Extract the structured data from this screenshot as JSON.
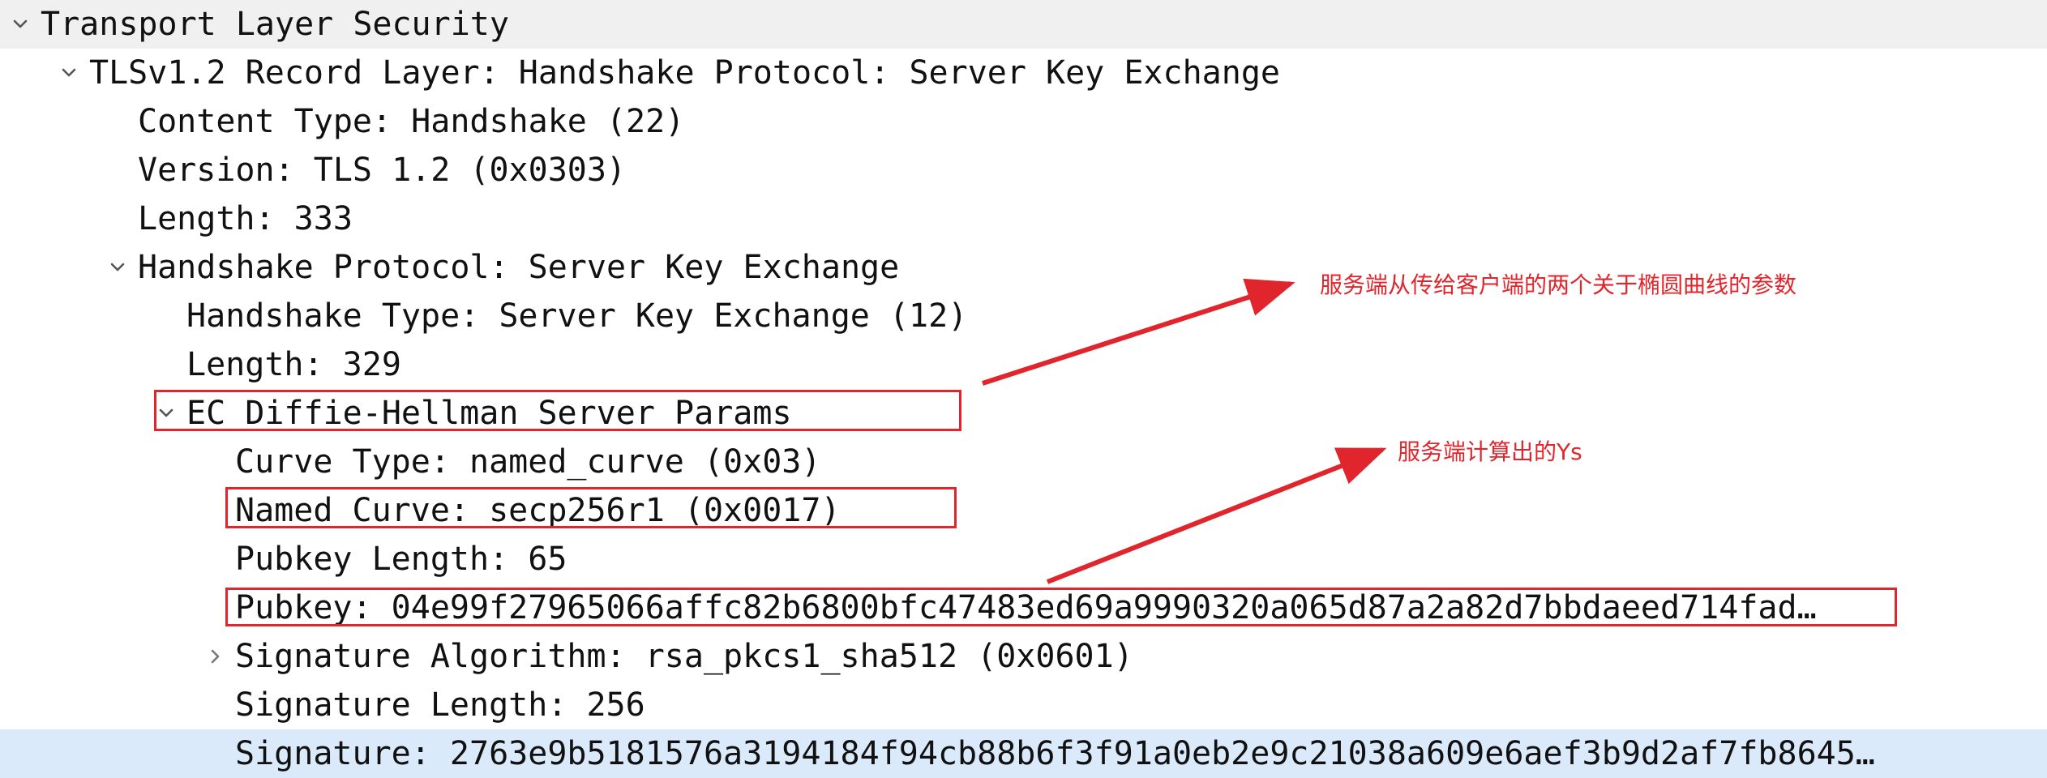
{
  "tree": {
    "rows": [
      {
        "text": "Transport Layer Security",
        "toggle": "expanded"
      },
      {
        "text": "TLSv1.2 Record Layer: Handshake Protocol: Server Key Exchange",
        "toggle": "expanded"
      },
      {
        "text": "Content Type: Handshake (22)",
        "toggle": "none"
      },
      {
        "text": "Version: TLS 1.2 (0x0303)",
        "toggle": "none"
      },
      {
        "text": "Length: 333",
        "toggle": "none"
      },
      {
        "text": "Handshake Protocol: Server Key Exchange",
        "toggle": "expanded"
      },
      {
        "text": "Handshake Type: Server Key Exchange (12)",
        "toggle": "none"
      },
      {
        "text": "Length: 329",
        "toggle": "none"
      },
      {
        "text": "EC Diffie-Hellman Server Params",
        "toggle": "expanded"
      },
      {
        "text": "Curve Type: named_curve (0x03)",
        "toggle": "none"
      },
      {
        "text": "Named Curve: secp256r1 (0x0017)",
        "toggle": "none"
      },
      {
        "text": "Pubkey Length: 65",
        "toggle": "none"
      },
      {
        "text": "Pubkey: 04e99f27965066affc82b6800bfc47483ed69a9990320a065d87a2a82d7bbdaeed714fad…",
        "toggle": "none"
      },
      {
        "text": "Signature Algorithm: rsa_pkcs1_sha512 (0x0601)",
        "toggle": "collapsed"
      },
      {
        "text": "Signature Length: 256",
        "toggle": "none"
      },
      {
        "text": "Signature: 2763e9b5181576a3194184f94cb88b6f3f91a0eb2e9c21038a609e6aef3b9d2af7fb8645…",
        "toggle": "none",
        "selected": true
      }
    ]
  },
  "annotations": {
    "ecdh_params_note": "服务端从传给客户端的两个关于椭圆曲线的参数",
    "pubkey_note": "服务端计算出的Ys"
  },
  "colors": {
    "annotation": "#e0262c",
    "selected_row": "#dbeafa",
    "top_row": "#f0f0f0",
    "text": "#111111"
  },
  "icons": {
    "expanded": "chevron-down-icon",
    "collapsed": "chevron-right-icon"
  }
}
